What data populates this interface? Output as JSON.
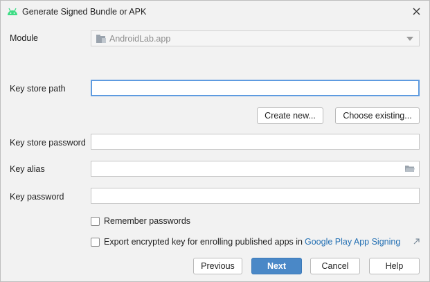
{
  "window": {
    "title": "Generate Signed Bundle or APK",
    "icon": "android-icon",
    "accent_color": "#3ddc84"
  },
  "module": {
    "label": "Module",
    "value": "AndroidLab.app",
    "icon": "module-folder-icon"
  },
  "key_store_path": {
    "label": "Key store path",
    "value": "",
    "create_new_label": "Create new...",
    "choose_existing_label": "Choose existing..."
  },
  "key_store_password": {
    "label": "Key store password",
    "value": ""
  },
  "key_alias": {
    "label": "Key alias",
    "value": "",
    "icon": "folder-icon"
  },
  "key_password": {
    "label": "Key password",
    "value": ""
  },
  "remember_passwords": {
    "label": "Remember passwords",
    "checked": false
  },
  "export_key": {
    "label": "Export encrypted key for enrolling published apps in",
    "link_text": "Google Play App Signing",
    "checked": false
  },
  "footer": {
    "previous_label": "Previous",
    "next_label": "Next",
    "cancel_label": "Cancel",
    "help_label": "Help",
    "primary_color": "#4a88c7"
  }
}
